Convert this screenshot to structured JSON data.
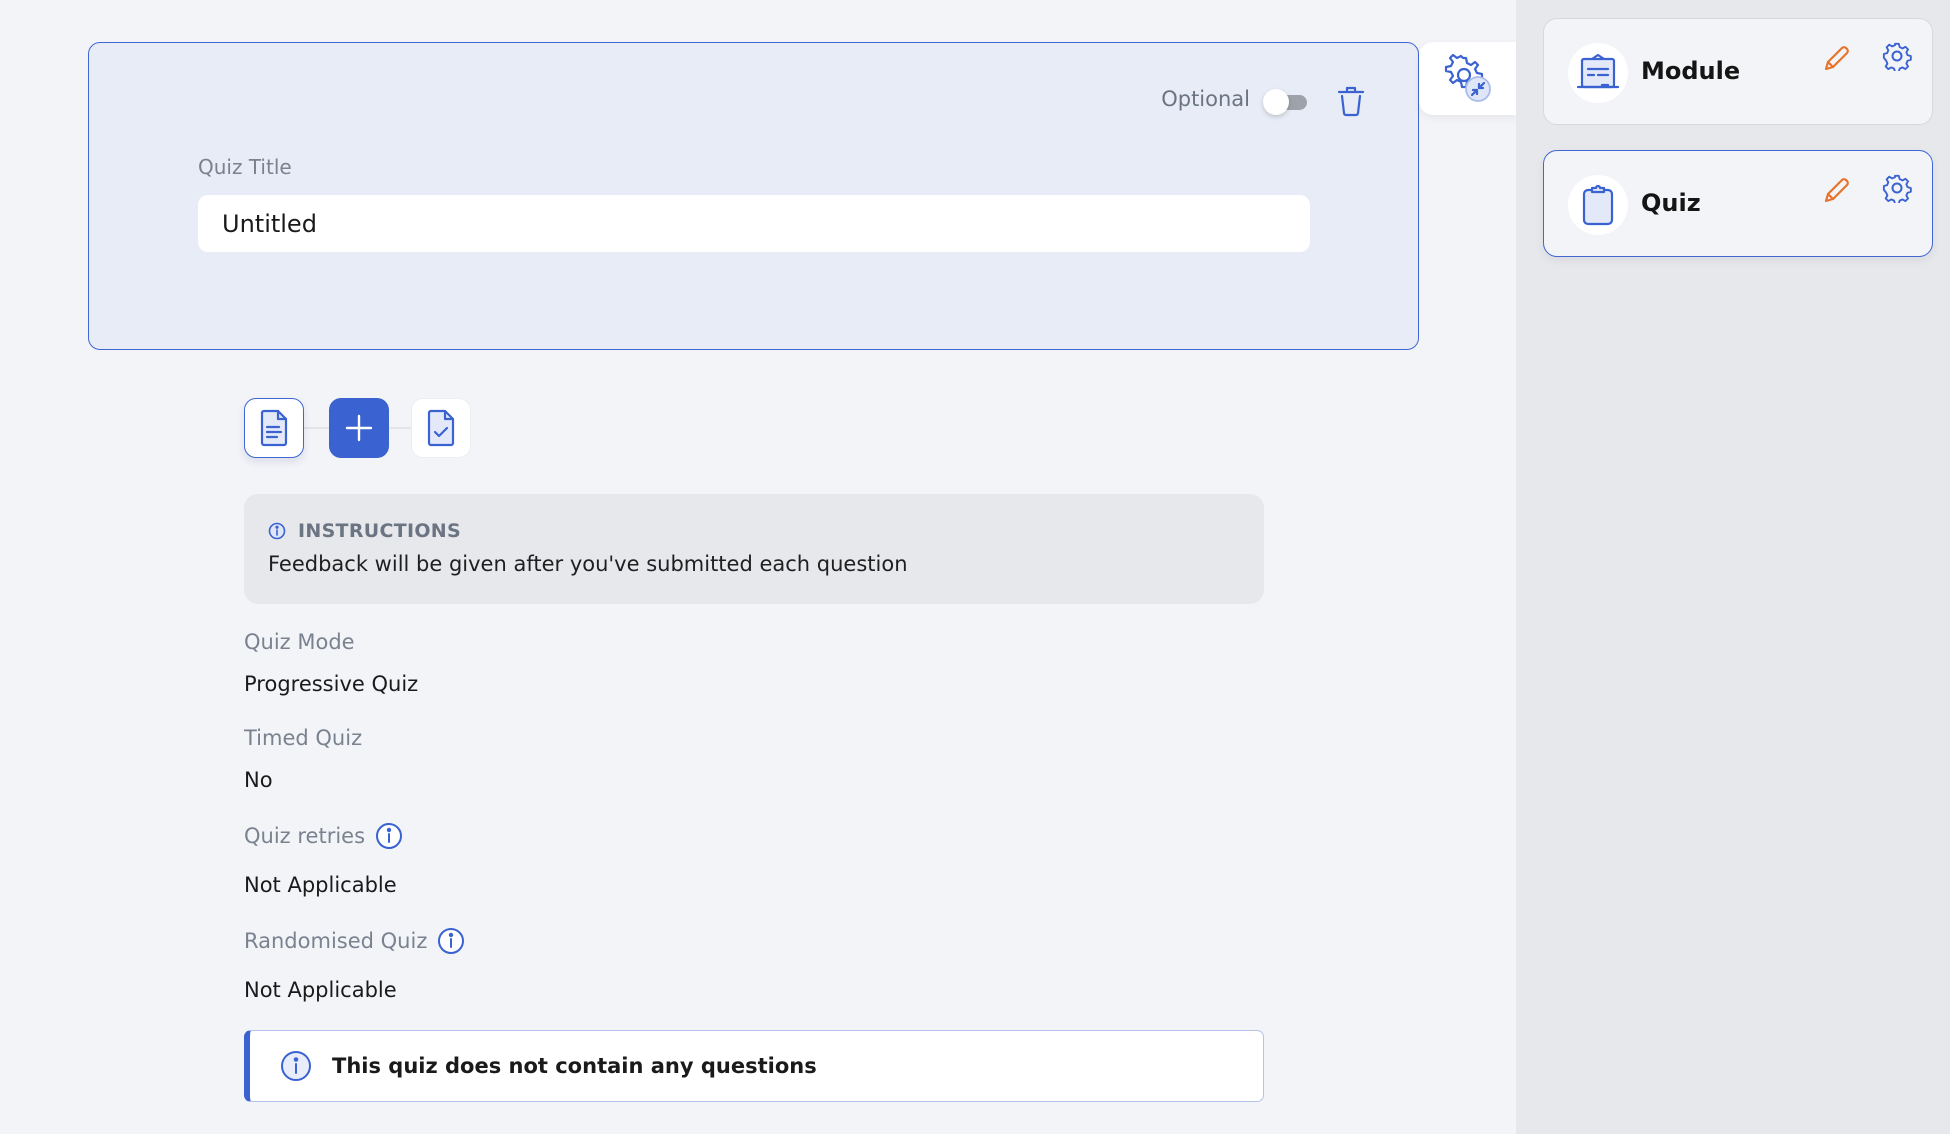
{
  "quiz_card": {
    "optional_label": "Optional",
    "optional_enabled": false,
    "title_label": "Quiz Title",
    "title_value": "Untitled"
  },
  "toolbar": {
    "buttons": [
      {
        "name": "document",
        "icon": "document-icon"
      },
      {
        "name": "add",
        "icon": "plus-icon"
      },
      {
        "name": "quiz",
        "icon": "clipboard-check-icon"
      }
    ]
  },
  "instructions": {
    "title": "INSTRUCTIONS",
    "text": "Feedback will be given after you've submitted each question"
  },
  "fields": [
    {
      "label": "Quiz Mode",
      "value": "Progressive Quiz",
      "has_info": false
    },
    {
      "label": "Timed Quiz",
      "value": "No",
      "has_info": false
    },
    {
      "label": "Quiz retries",
      "value": "Not Applicable",
      "has_info": true
    },
    {
      "label": "Randomised Quiz",
      "value": "Not Applicable",
      "has_info": true
    }
  ],
  "alert": {
    "text": "This quiz does not contain any questions"
  },
  "sidebar": {
    "items": [
      {
        "label": "Module",
        "icon": "module-icon",
        "selected": false
      },
      {
        "label": "Quiz",
        "icon": "clipboard-icon",
        "selected": true
      }
    ]
  },
  "colors": {
    "accent": "#3a62d1",
    "edit": "#e8732a",
    "muted_text": "#7a8290",
    "card_bg": "#e8ecf6"
  }
}
